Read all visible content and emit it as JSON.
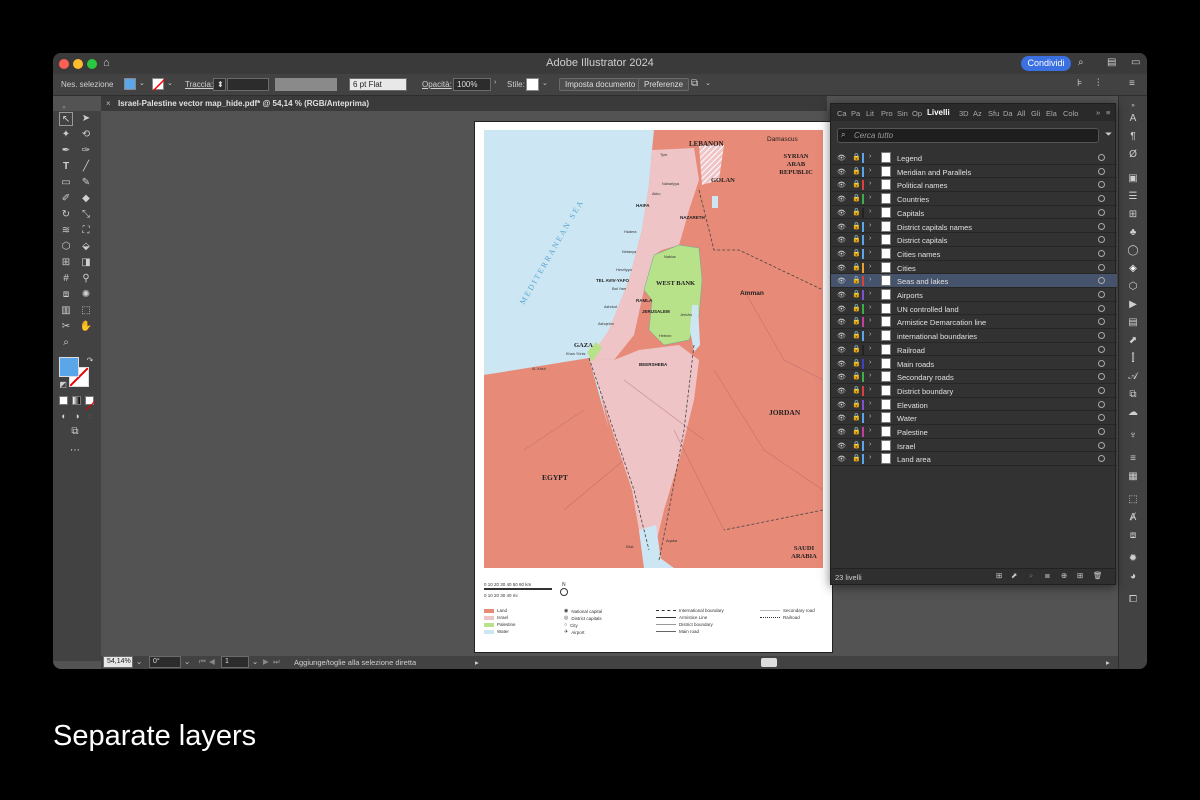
{
  "window": {
    "title": "Adobe Illustrator 2024",
    "share_label": "Condividi"
  },
  "controlbar": {
    "selection_label": "Nes. selezione",
    "stroke_label": "Traccia:",
    "stroke_profile": "6 pt Flat",
    "opacity_label": "Opacità:",
    "opacity_value": "100%",
    "style_label": "Stile:",
    "doc_setup": "Imposta documento",
    "preferences": "Preferenze",
    "fill_color": "#5aa6e8"
  },
  "document": {
    "tab_title": "Israel-Palestine vector map_hide.pdf* @ 54,14 % (RGB/Anteprima)"
  },
  "map": {
    "labels": {
      "lebanon": "LEBANON",
      "damascus": "Damascus",
      "syria": "SYRIAN ARAB REPUBLIC",
      "golan": "GOLAN",
      "haifa": "HAIFA",
      "nazareth": "NAZARETH",
      "sea": "MEDITERRANEAN SEA",
      "tel_aviv": "TEL AVIV-YAFO",
      "west_bank": "WEST BANK",
      "ramla": "RAMLA",
      "jerusalem": "JERUSALEM",
      "amman": "Amman",
      "gaza": "GAZA",
      "beersheba": "BEERSHEBA",
      "jordan": "JORDAN",
      "egypt": "EGYPT",
      "saudi": "SAUDI ARABIA",
      "tyre": "Tyre",
      "nahariyya": "Nahariyya",
      "akko": "Akko",
      "hadera": "Hadera",
      "netanya": "Netanya",
      "herzliyya": "Herzliyya",
      "bat_yam": "Bat Yam",
      "ashdod": "Ashdod",
      "ashqelon": "Ashqelon",
      "khan_yunis": "Khan Yūnis",
      "hebron": "Hebron",
      "nablus": "Nablus",
      "jericho": "Jericho",
      "al_arish": "Al 'Arish",
      "eilat": "Eilat",
      "aqaba": "Aqaba"
    },
    "colors": {
      "land": "#e88a78",
      "israel": "#eec4c7",
      "palestine": "#b8e28a",
      "water": "#cce6f3"
    }
  },
  "legend": {
    "scale_km": "0 10 20 30 40 50 60 km",
    "scale_mi": "0 10 20 30 40 mi",
    "north": "N",
    "items_col1": [
      "Land",
      "Israel",
      "Palestine",
      "Water"
    ],
    "items_col2": [
      "National capital",
      "District capitals",
      "City",
      "Airport"
    ],
    "items_col3": [
      "International boundary",
      "Armistice Line",
      "District boundary",
      "Main road"
    ],
    "items_col4": [
      "Secondary road",
      "Railroad"
    ]
  },
  "status": {
    "zoom": "54,14%",
    "rotation": "0°",
    "page": "1",
    "message": "Aggiunge/toglie alla selezione diretta"
  },
  "panel": {
    "tabs": [
      "Ca",
      "Pa",
      "Lit",
      "Pro",
      "Sin",
      "Op",
      "Livelli",
      "3D",
      "Az",
      "Sfu",
      "Da",
      "All",
      "Gli",
      "Ela",
      "Colo"
    ],
    "search_placeholder": "Cerca tutto",
    "layers": [
      {
        "name": "Legend",
        "color": "#5aa6e8"
      },
      {
        "name": "Meridian and Parallels",
        "color": "#5aa6e8"
      },
      {
        "name": "Political names",
        "color": "#d94040"
      },
      {
        "name": "Countries",
        "color": "#3fae49"
      },
      {
        "name": "Capitals",
        "color": "#222222"
      },
      {
        "name": "District capitals names",
        "color": "#5aa6e8"
      },
      {
        "name": "District capitals",
        "color": "#5aa6e8"
      },
      {
        "name": "Cities names",
        "color": "#5aa6e8"
      },
      {
        "name": "Cities",
        "color": "#e8a030"
      },
      {
        "name": "Seas and lakes",
        "color": "#d94040"
      },
      {
        "name": "Airports",
        "color": "#8050d0"
      },
      {
        "name": "UN controlled land",
        "color": "#3fae49"
      },
      {
        "name": "Armistice Demarcation line",
        "color": "#c040a0"
      },
      {
        "name": "international boundaries",
        "color": "#5aa6e8"
      },
      {
        "name": "Railroad",
        "color": "#222222"
      },
      {
        "name": "Main roads",
        "color": "#4040c0"
      },
      {
        "name": "Secondary roads",
        "color": "#3fae49"
      },
      {
        "name": "District boundary",
        "color": "#d94040"
      },
      {
        "name": "Elevation",
        "color": "#8050d0"
      },
      {
        "name": "Water",
        "color": "#5aa6e8"
      },
      {
        "name": "Palestine",
        "color": "#c040a0"
      },
      {
        "name": "Israel",
        "color": "#5aa6e8"
      },
      {
        "name": "Land area",
        "color": "#5aa6e8"
      }
    ],
    "selected_index": 9,
    "footer_count": "23 livelli"
  },
  "caption": "Separate layers"
}
